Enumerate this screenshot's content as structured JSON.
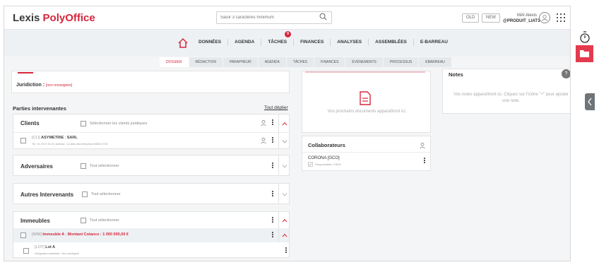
{
  "header": {
    "logo_part1": "Lexis ",
    "logo_part2": "PolyOffice",
    "search_placeholder": "Saisir 3 caractères minimum",
    "version_old": "OLD",
    "version_new": "NEW",
    "user_name": "MAI Alexis",
    "user_id": "@PRODUIT_LIAT3"
  },
  "nav": {
    "items": [
      "DONNÉES",
      "AGENDA",
      "TÂCHES",
      "FINANCES",
      "ANALYSES",
      "ASSEMBLÉES",
      "E-BARREAU"
    ],
    "tasks_badge": "9"
  },
  "subtabs": [
    "DOSSIER",
    "RÉDACTION",
    "PARAPHEUR",
    "AGENDA",
    "TÂCHES",
    "FINANCES",
    "ÉVÉNEMENTS",
    "PROCESSUS",
    "EBARREAU"
  ],
  "jurisdiction": {
    "label": "Juridiction : ",
    "value": "[non renseignée]"
  },
  "parties": {
    "title": "Parties intervenantes",
    "expand_all": "Tout déplier"
  },
  "clients": {
    "title": "Clients",
    "select_label": "Sélectionner les clients juridiques",
    "row_code": "[CLI]",
    "row_name": "ASYMETRIE",
    "row_type": "SARL",
    "row_detail": "Tél : 01 23 07 33 23  |  Adresse : 12 allée des entreprises 69600 LYON"
  },
  "adversaires": {
    "title": "Adversaires",
    "select_label": "Tout sélectionner"
  },
  "autres": {
    "title": "Autres Intervenants",
    "select_label": "Tout sélectionner"
  },
  "immeubles": {
    "title": "Immeubles",
    "select_label": "Tout sélectionner",
    "row_code": "[IMM]",
    "row_name": "Immeuble A",
    "row_amount": "Montant Cotance : 1 000 000,00 €",
    "lot_code": "[LOT]",
    "lot_name": "Lot A",
    "lot_detail": "Désignation cadastrale : Non renseignée"
  },
  "documents": {
    "empty_text": "Vos prochains documents apparaîtront ici."
  },
  "collaborateurs": {
    "title": "Collaborateurs",
    "name": "CORONA [GCO]",
    "role": "Responsable | 100%"
  },
  "notes": {
    "title": "Notes",
    "help": "?",
    "empty_text": "Vos notes apparaîtront ici. Cliquez sur l'icône \"+\" pour ajouter une note."
  },
  "colors": {
    "brand_red": "#d7263d",
    "nav_bg": "#eef1f4",
    "content_bg": "#f4f5f6"
  }
}
